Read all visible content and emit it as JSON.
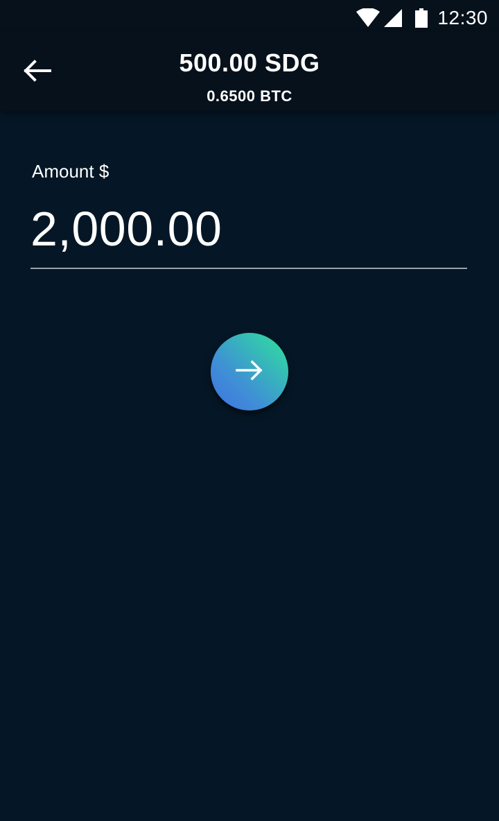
{
  "status_bar": {
    "time": "12:30",
    "icons": [
      "wifi-icon",
      "cellular-signal-icon",
      "battery-icon"
    ]
  },
  "header": {
    "back_icon": "arrow-left-icon",
    "title": "500.00 SDG",
    "subtitle": "0.6500 BTC"
  },
  "form": {
    "amount_label": "Amount $",
    "amount_value": "2,000.00"
  },
  "next_button": {
    "icon": "arrow-right-icon",
    "gradient_colors": [
      "#2ee39b",
      "#3f72e0"
    ]
  },
  "colors": {
    "background": "#051726",
    "app_bar": "#07111c",
    "text": "#ffffff",
    "divider": "#9aa3ab"
  }
}
